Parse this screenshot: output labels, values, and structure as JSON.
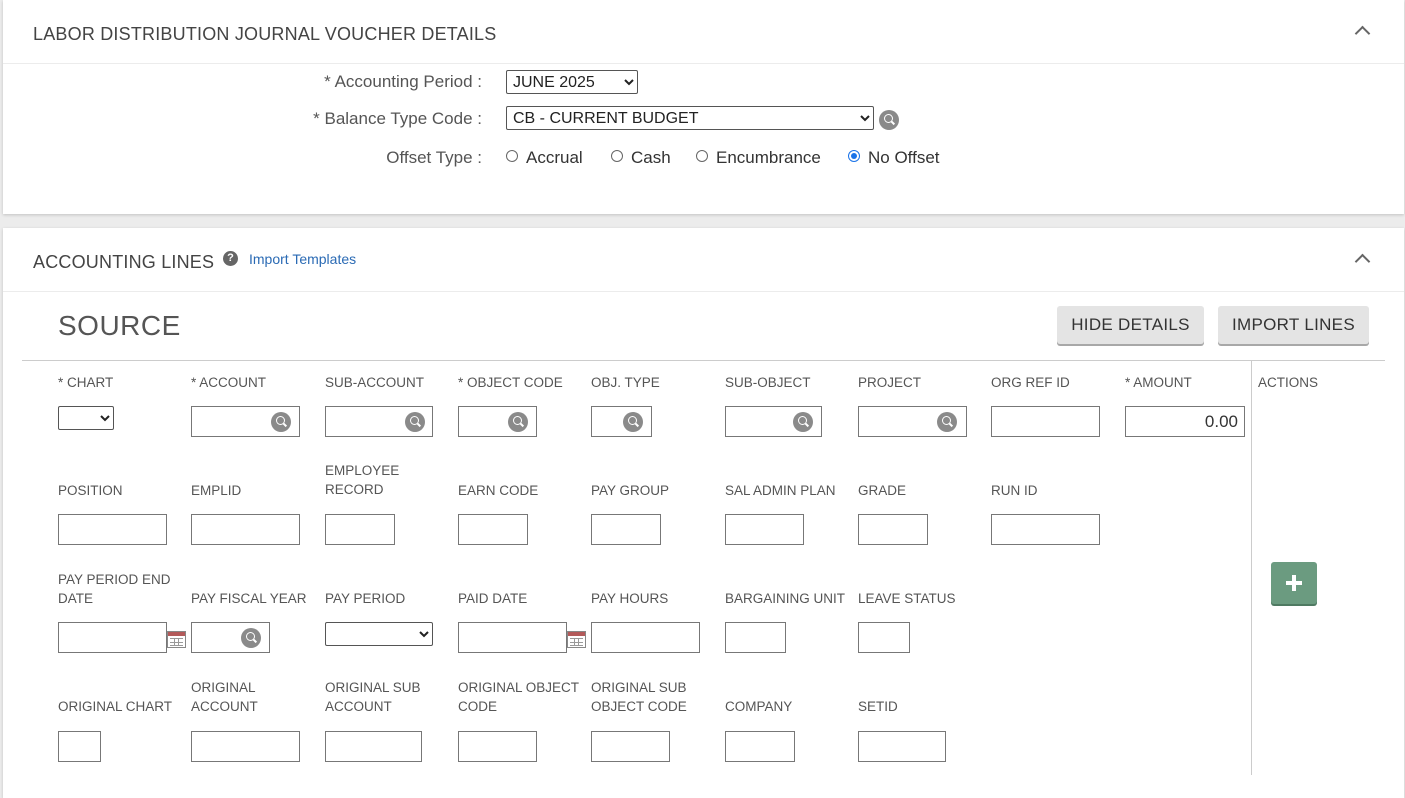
{
  "details": {
    "title": "LABOR DISTRIBUTION JOURNAL VOUCHER DETAILS",
    "accounting_period_label": "* Accounting Period :",
    "accounting_period_value": "JUNE 2025",
    "balance_type_label": "* Balance Type Code :",
    "balance_type_value": "CB - CURRENT BUDGET",
    "offset_type_label": "Offset Type :",
    "offset_options": [
      {
        "label": "Accrual",
        "selected": false
      },
      {
        "label": "Cash",
        "selected": false
      },
      {
        "label": "Encumbrance",
        "selected": false
      },
      {
        "label": "No Offset",
        "selected": true
      }
    ]
  },
  "accounting_lines": {
    "title": "ACCOUNTING LINES",
    "help_glyph": "?",
    "import_templates_link": "Import Templates",
    "source_title": "SOURCE",
    "hide_details_button": "HIDE DETAILS",
    "import_lines_button": "IMPORT LINES",
    "actions_label": "ACTIONS",
    "amount_value": "0.00",
    "columns": {
      "chart": "* CHART",
      "account": "* ACCOUNT",
      "sub_account": "SUB-ACCOUNT",
      "object_code": "* OBJECT CODE",
      "obj_type": "OBJ. TYPE",
      "sub_object": "SUB-OBJECT",
      "project": "PROJECT",
      "org_ref_id": "ORG REF ID",
      "amount": "* AMOUNT",
      "position": "POSITION",
      "emplid": "EMPLID",
      "employee_record": "EMPLOYEE RECORD",
      "earn_code": "EARN CODE",
      "pay_group": "PAY GROUP",
      "sal_admin_plan": "SAL ADMIN PLAN",
      "grade": "GRADE",
      "run_id": "RUN ID",
      "pay_period_end_date": "PAY PERIOD END DATE",
      "pay_fiscal_year": "PAY FISCAL YEAR",
      "pay_period": "PAY PERIOD",
      "paid_date": "PAID DATE",
      "pay_hours": "PAY HOURS",
      "bargaining_unit": "BARGAINING UNIT",
      "leave_status": "LEAVE STATUS",
      "original_chart": "ORIGINAL CHART",
      "original_account": "ORIGINAL ACCOUNT",
      "original_sub_account": "ORIGINAL SUB ACCOUNT",
      "original_object_code": "ORIGINAL OBJECT CODE",
      "original_sub_object_code": "ORIGINAL SUB OBJECT CODE",
      "company": "COMPANY",
      "setid": "SETID"
    }
  }
}
